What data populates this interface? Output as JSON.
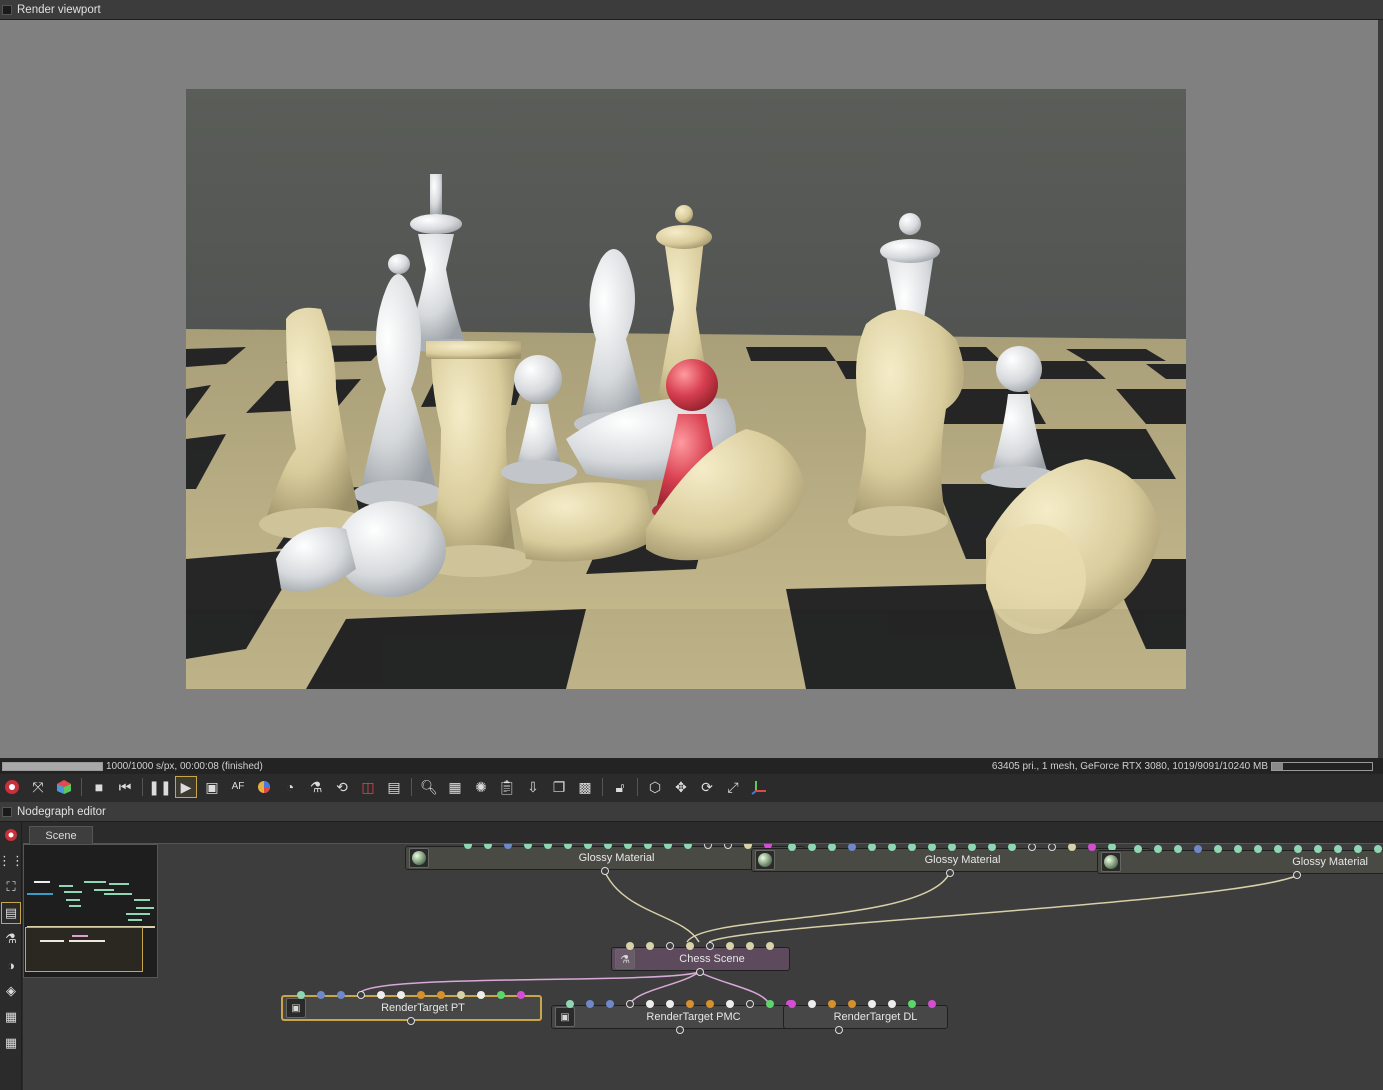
{
  "viewport": {
    "title": "Render viewport"
  },
  "status": {
    "progress_text": "1000/1000 s/px, 00:00:08 (finished)",
    "progress_fraction": 1.0,
    "gpu_text": "63405 pri., 1 mesh, GeForce RTX 3080, 1019/9091/10240 MB",
    "gpu_fraction": 0.11
  },
  "toolbar": {
    "af_label": "AF"
  },
  "nodegraph": {
    "title": "Nodegraph editor",
    "tab": "Scene",
    "nodes": {
      "glossy1": "Glossy Material",
      "glossy2": "Glossy Material",
      "glossy3": "Glossy Material",
      "scene": "Chess Scene",
      "rt_pt": "RenderTarget PT",
      "rt_pmc": "RenderTarget PMC",
      "rt_dl": "RenderTarget DL"
    }
  },
  "colors": {
    "accent": "#c8a64a",
    "pin_teal": "#8fd6b4",
    "pin_blue": "#6e88c8",
    "pin_orange": "#d6902e",
    "pin_pink": "#d44ed4",
    "pin_cream": "#d8d2a8",
    "pin_green": "#5cd66a",
    "wire_material": "#d8d0a8",
    "wire_scene": "#d8a8d8"
  }
}
